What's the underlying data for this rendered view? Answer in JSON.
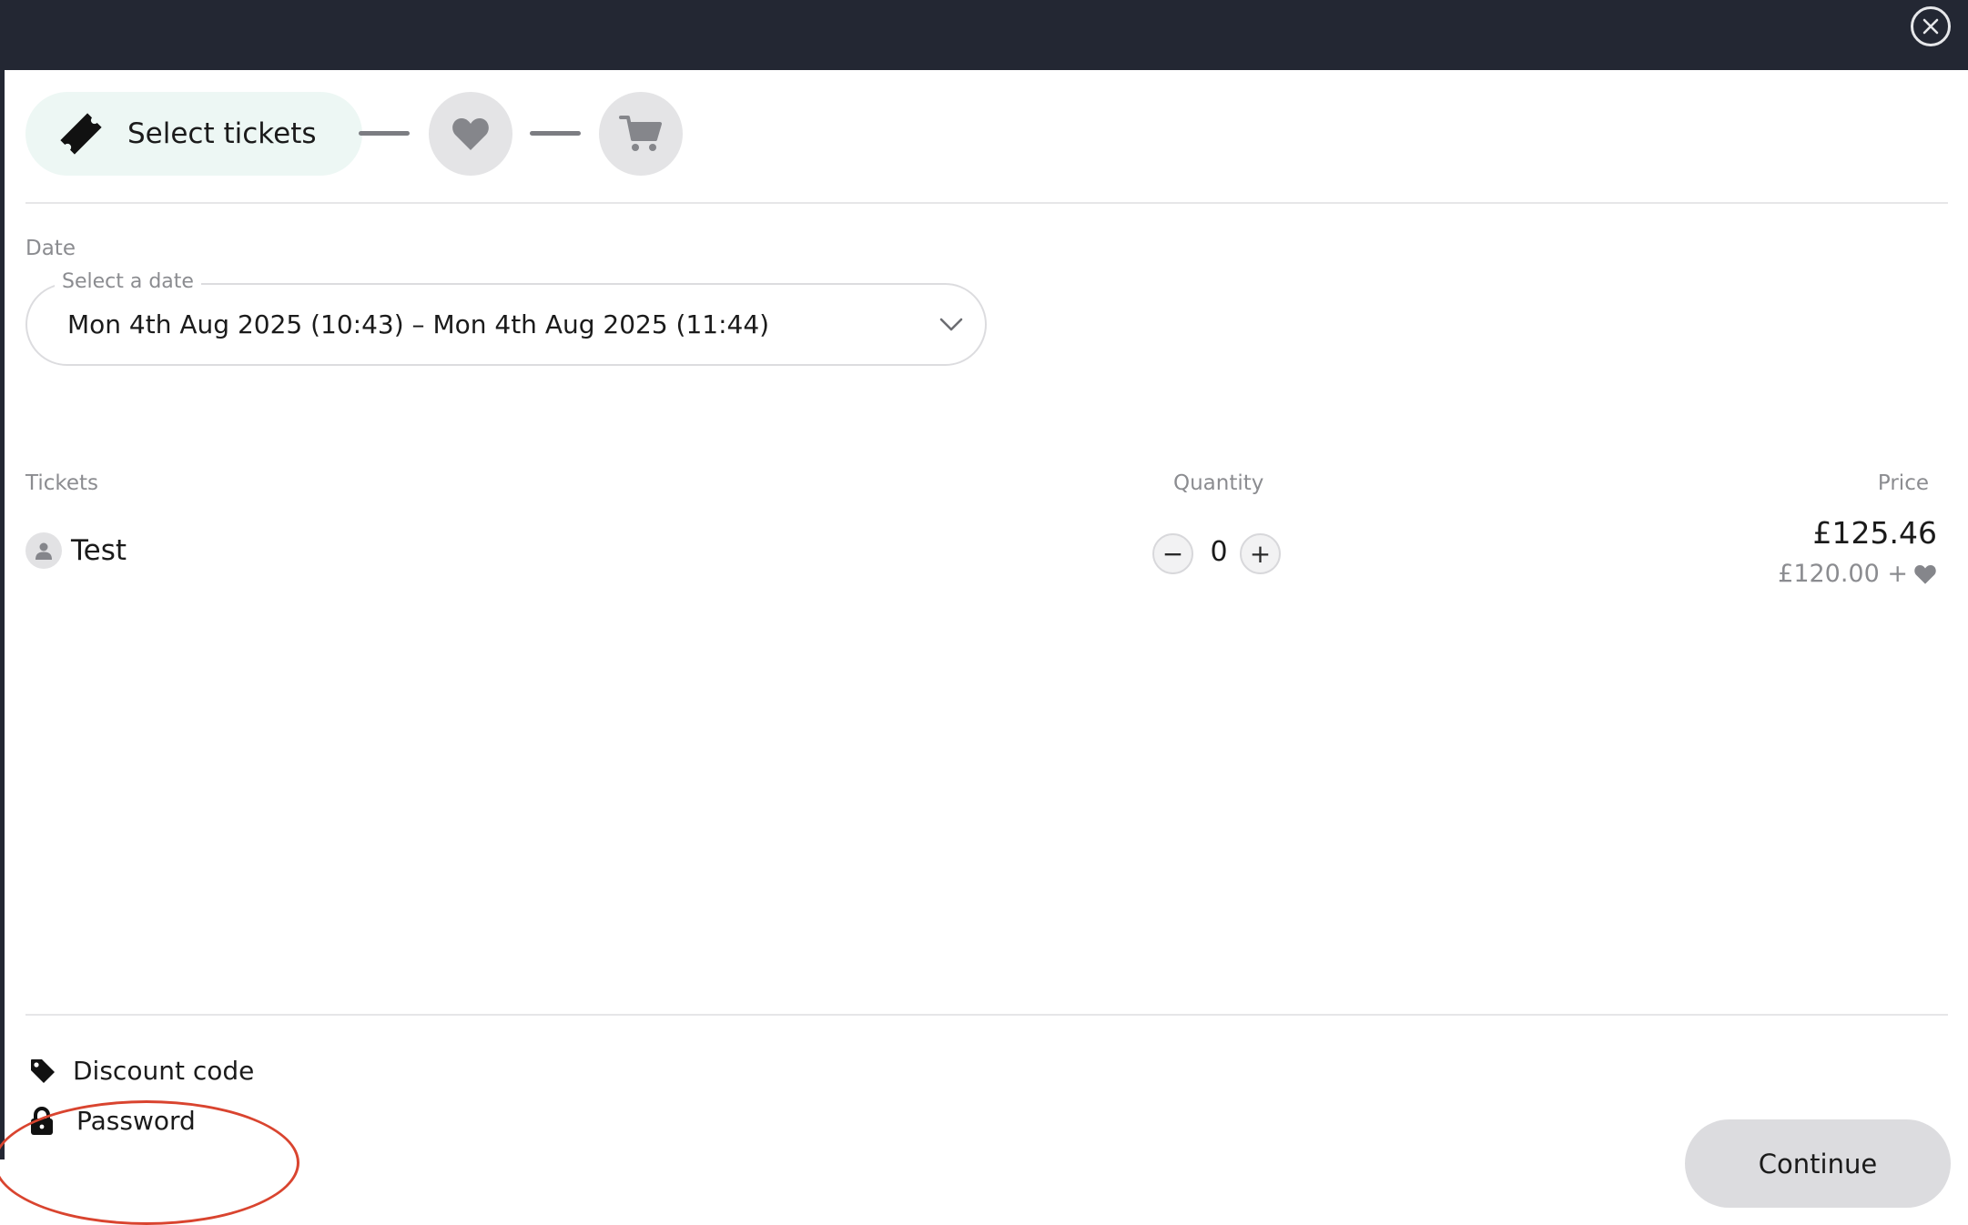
{
  "stepper": {
    "active_label": "Select tickets",
    "steps": [
      {
        "icon": "ticket-icon",
        "state": "active"
      },
      {
        "icon": "heart-icon",
        "state": "upcoming"
      },
      {
        "icon": "cart-icon",
        "state": "upcoming"
      }
    ]
  },
  "date": {
    "section_label": "Date",
    "select_legend": "Select a date",
    "selected_value": "Mon 4th Aug 2025 (10:43) – Mon 4th Aug 2025 (11:44)"
  },
  "tickets_table": {
    "headers": {
      "tickets": "Tickets",
      "quantity": "Quantity",
      "price": "Price"
    },
    "rows": [
      {
        "name": "Test",
        "icon": "person-icon",
        "quantity": "0",
        "decrement_label": "−",
        "increment_label": "+",
        "price": "£125.46",
        "price_breakdown": "£120.00 +"
      }
    ]
  },
  "footer": {
    "discount_label": "Discount code",
    "password_label": "Password",
    "continue_label": "Continue"
  },
  "colors": {
    "topbar": "#232733",
    "step_active_bg": "#edf7f4",
    "step_inactive_bg": "#e4e4e6",
    "continue_bg": "#dcdcdf",
    "highlight": "#d9442f"
  }
}
